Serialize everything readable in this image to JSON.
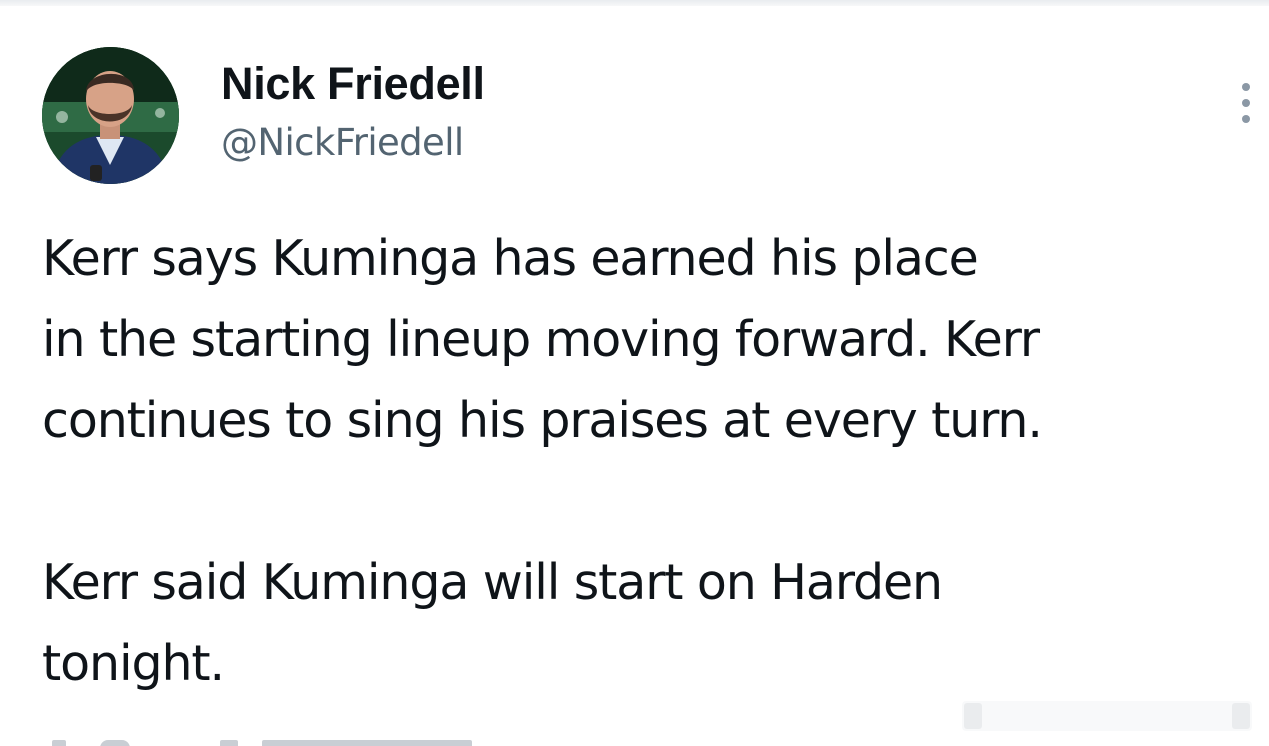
{
  "tweet": {
    "author": {
      "display_name": "Nick Friedell",
      "handle": "@NickFriedell",
      "avatar_icon": "profile-photo"
    },
    "more_icon": "vertical-dots-icon",
    "text": {
      "paragraph_1": [
        "Kerr says Kuminga has earned his place",
        "in the starting lineup moving forward. Kerr",
        "continues to sing his praises at every turn."
      ],
      "paragraph_2": [
        "Kerr said Kuminga will start on Harden",
        "tonight."
      ]
    }
  },
  "colors": {
    "text_primary": "#0f1419",
    "text_secondary": "#536471",
    "icon_gray": "#8b98a5"
  }
}
